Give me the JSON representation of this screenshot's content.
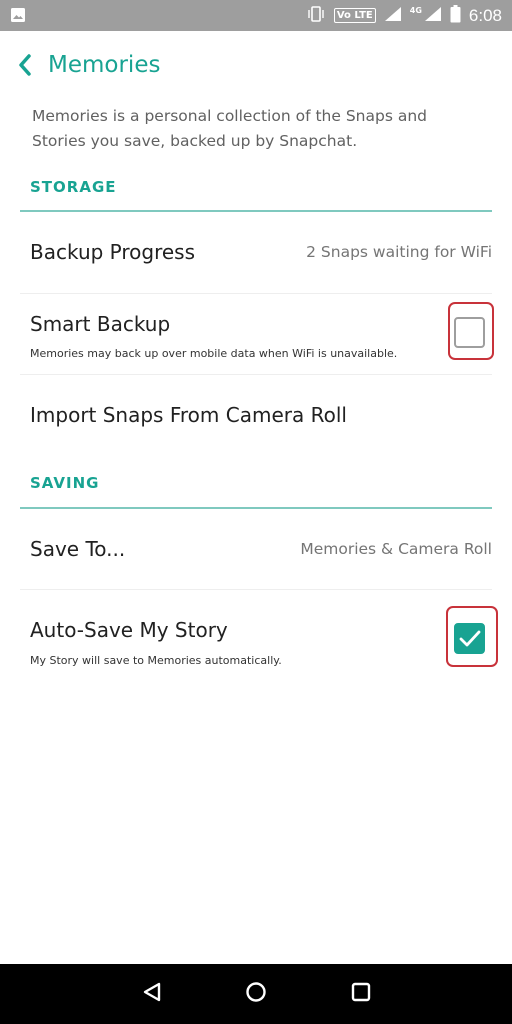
{
  "status_bar": {
    "lte_label": "Vo LTE",
    "network_label": "4G",
    "time": "6:08"
  },
  "header": {
    "title": "Memories"
  },
  "description": "Memories is a personal collection of the Snaps and Stories you save, backed up by Snapchat.",
  "storage": {
    "label": "STORAGE",
    "backup_progress": {
      "title": "Backup Progress",
      "value": "2 Snaps waiting for WiFi"
    },
    "smart_backup": {
      "title": "Smart Backup",
      "subtitle": "Memories may back up over mobile data when WiFi is unavailable.",
      "checked": false
    },
    "import": {
      "title": "Import Snaps From Camera Roll"
    }
  },
  "saving": {
    "label": "SAVING",
    "save_to": {
      "title": "Save To...",
      "value": "Memories & Camera Roll"
    },
    "auto_save": {
      "title": "Auto-Save My Story",
      "subtitle": "My Story will save to Memories automatically.",
      "checked": true
    }
  },
  "colors": {
    "accent": "#18a392",
    "highlight": "#c8323a",
    "status_bar": "#9e9e9e",
    "nav_bar": "#000000"
  },
  "icons": {
    "back": "chevron-left-icon",
    "nav_back": "triangle-back-icon",
    "nav_home": "circle-home-icon",
    "nav_recents": "square-recents-icon"
  }
}
